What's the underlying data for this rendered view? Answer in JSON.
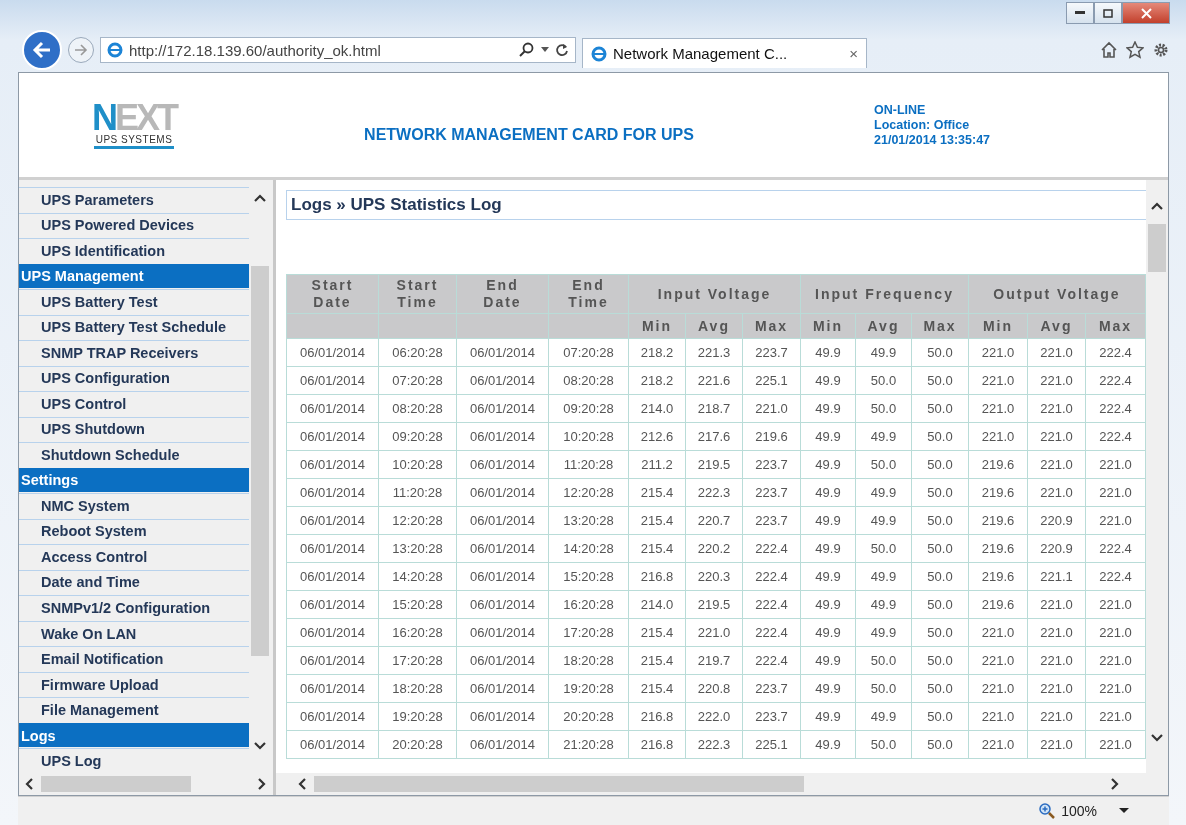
{
  "browser": {
    "url": "http://172.18.139.60/authority_ok.html",
    "tab_title": "Network Management C...",
    "tab_close": "×"
  },
  "header": {
    "logo": "NEXT",
    "logo_sub": "UPS SYSTEMS",
    "title": "NETWORK MANAGEMENT CARD FOR UPS",
    "status": "ON-LINE",
    "location": "Location: Office",
    "datetime": "21/01/2014 13:35:47"
  },
  "sidebar": {
    "items": [
      {
        "label": "UPS Parameters",
        "kind": "item"
      },
      {
        "label": "UPS Powered Devices",
        "kind": "item"
      },
      {
        "label": "UPS Identification",
        "kind": "item"
      },
      {
        "label": "UPS Management",
        "kind": "section"
      },
      {
        "label": "UPS Battery Test",
        "kind": "item"
      },
      {
        "label": "UPS Battery Test Schedule",
        "kind": "item"
      },
      {
        "label": "SNMP TRAP Receivers",
        "kind": "item"
      },
      {
        "label": "UPS Configuration",
        "kind": "item"
      },
      {
        "label": "UPS Control",
        "kind": "item"
      },
      {
        "label": "UPS Shutdown",
        "kind": "item"
      },
      {
        "label": "Shutdown Schedule",
        "kind": "item"
      },
      {
        "label": "Settings",
        "kind": "section"
      },
      {
        "label": "NMC System",
        "kind": "item"
      },
      {
        "label": "Reboot System",
        "kind": "item"
      },
      {
        "label": "Access Control",
        "kind": "item"
      },
      {
        "label": "Date and Time",
        "kind": "item"
      },
      {
        "label": "SNMPv1/2 Configuration",
        "kind": "item"
      },
      {
        "label": "Wake On LAN",
        "kind": "item"
      },
      {
        "label": "Email Notification",
        "kind": "item"
      },
      {
        "label": "Firmware Upload",
        "kind": "item"
      },
      {
        "label": "File Management",
        "kind": "item"
      },
      {
        "label": "Logs",
        "kind": "section"
      },
      {
        "label": "UPS Log",
        "kind": "item"
      }
    ]
  },
  "content": {
    "breadcrumb": "Logs » UPS Statistics Log",
    "table": {
      "groups": [
        {
          "label": "Start Date"
        },
        {
          "label": "Start Time"
        },
        {
          "label": "End Date"
        },
        {
          "label": "End Time"
        },
        {
          "label": "Input Voltage",
          "subcolumns": [
            "Min",
            "Avg",
            "Max"
          ]
        },
        {
          "label": "Input Frequency",
          "subcolumns": [
            "Min",
            "Avg",
            "Max"
          ]
        },
        {
          "label": "Output Voltage",
          "subcolumns": [
            "Min",
            "Avg",
            "Max"
          ]
        }
      ],
      "rows": [
        [
          "06/01/2014",
          "06:20:28",
          "06/01/2014",
          "07:20:28",
          "218.2",
          "221.3",
          "223.7",
          "49.9",
          "49.9",
          "50.0",
          "221.0",
          "221.0",
          "222.4"
        ],
        [
          "06/01/2014",
          "07:20:28",
          "06/01/2014",
          "08:20:28",
          "218.2",
          "221.6",
          "225.1",
          "49.9",
          "50.0",
          "50.0",
          "221.0",
          "221.0",
          "222.4"
        ],
        [
          "06/01/2014",
          "08:20:28",
          "06/01/2014",
          "09:20:28",
          "214.0",
          "218.7",
          "221.0",
          "49.9",
          "50.0",
          "50.0",
          "221.0",
          "221.0",
          "222.4"
        ],
        [
          "06/01/2014",
          "09:20:28",
          "06/01/2014",
          "10:20:28",
          "212.6",
          "217.6",
          "219.6",
          "49.9",
          "49.9",
          "50.0",
          "221.0",
          "221.0",
          "222.4"
        ],
        [
          "06/01/2014",
          "10:20:28",
          "06/01/2014",
          "11:20:28",
          "211.2",
          "219.5",
          "223.7",
          "49.9",
          "50.0",
          "50.0",
          "219.6",
          "221.0",
          "221.0"
        ],
        [
          "06/01/2014",
          "11:20:28",
          "06/01/2014",
          "12:20:28",
          "215.4",
          "222.3",
          "223.7",
          "49.9",
          "49.9",
          "50.0",
          "219.6",
          "221.0",
          "221.0"
        ],
        [
          "06/01/2014",
          "12:20:28",
          "06/01/2014",
          "13:20:28",
          "215.4",
          "220.7",
          "223.7",
          "49.9",
          "49.9",
          "50.0",
          "219.6",
          "220.9",
          "221.0"
        ],
        [
          "06/01/2014",
          "13:20:28",
          "06/01/2014",
          "14:20:28",
          "215.4",
          "220.2",
          "222.4",
          "49.9",
          "50.0",
          "50.0",
          "219.6",
          "220.9",
          "222.4"
        ],
        [
          "06/01/2014",
          "14:20:28",
          "06/01/2014",
          "15:20:28",
          "216.8",
          "220.3",
          "222.4",
          "49.9",
          "49.9",
          "50.0",
          "219.6",
          "221.1",
          "222.4"
        ],
        [
          "06/01/2014",
          "15:20:28",
          "06/01/2014",
          "16:20:28",
          "214.0",
          "219.5",
          "222.4",
          "49.9",
          "49.9",
          "50.0",
          "219.6",
          "221.0",
          "221.0"
        ],
        [
          "06/01/2014",
          "16:20:28",
          "06/01/2014",
          "17:20:28",
          "215.4",
          "221.0",
          "222.4",
          "49.9",
          "49.9",
          "50.0",
          "221.0",
          "221.0",
          "221.0"
        ],
        [
          "06/01/2014",
          "17:20:28",
          "06/01/2014",
          "18:20:28",
          "215.4",
          "219.7",
          "222.4",
          "49.9",
          "50.0",
          "50.0",
          "221.0",
          "221.0",
          "221.0"
        ],
        [
          "06/01/2014",
          "18:20:28",
          "06/01/2014",
          "19:20:28",
          "215.4",
          "220.8",
          "223.7",
          "49.9",
          "50.0",
          "50.0",
          "221.0",
          "221.0",
          "221.0"
        ],
        [
          "06/01/2014",
          "19:20:28",
          "06/01/2014",
          "20:20:28",
          "216.8",
          "222.0",
          "223.7",
          "49.9",
          "49.9",
          "50.0",
          "221.0",
          "221.0",
          "221.0"
        ],
        [
          "06/01/2014",
          "20:20:28",
          "06/01/2014",
          "21:20:28",
          "216.8",
          "222.3",
          "225.1",
          "49.9",
          "50.0",
          "50.0",
          "221.0",
          "221.0",
          "221.0"
        ]
      ]
    }
  },
  "status_bar": {
    "zoom": "100%"
  }
}
